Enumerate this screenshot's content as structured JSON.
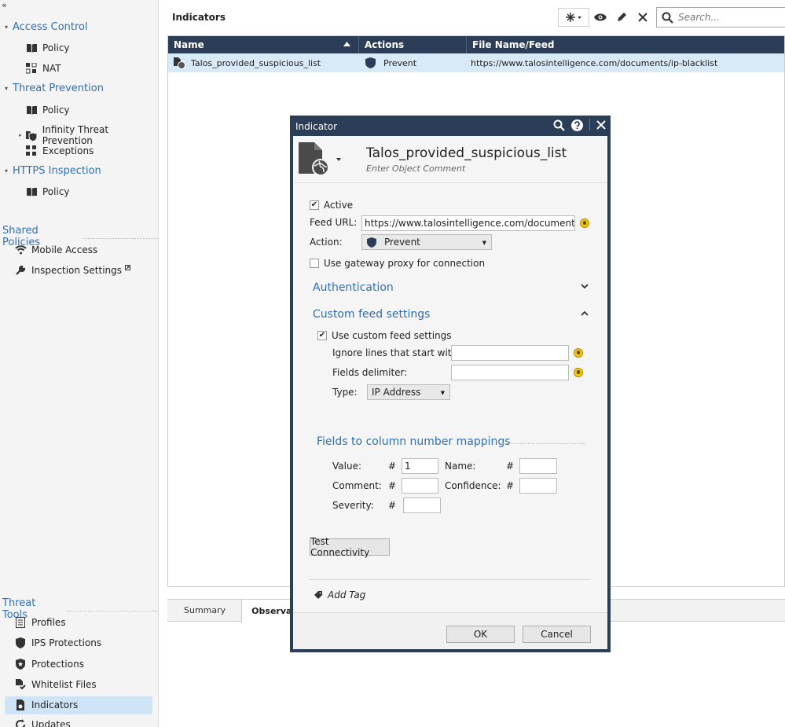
{
  "sidebar": {
    "collapse_glyph": "«",
    "sections": [
      {
        "label": "Access Control",
        "items": [
          {
            "label": "Policy",
            "icon": "book-icon"
          },
          {
            "label": "NAT",
            "icon": "nat-icon"
          }
        ]
      },
      {
        "label": "Threat Prevention",
        "items": [
          {
            "label": "Policy",
            "icon": "book-icon"
          },
          {
            "label": "Infinity Threat Prevention",
            "icon": "shield-book-icon"
          },
          {
            "label": "Exceptions",
            "icon": "exceptions-icon"
          }
        ]
      },
      {
        "label": "HTTPS Inspection",
        "items": [
          {
            "label": "Policy",
            "icon": "book-icon"
          }
        ]
      }
    ],
    "shared_policies": {
      "label": "Shared Policies",
      "items": [
        {
          "label": "Mobile Access",
          "icon": "wifi-icon"
        },
        {
          "label": "Inspection Settings",
          "icon": "wrench-icon"
        }
      ]
    },
    "threat_tools": {
      "label": "Threat Tools",
      "items": [
        {
          "label": "Profiles",
          "icon": "list-icon"
        },
        {
          "label": "IPS Protections",
          "icon": "shield-icon"
        },
        {
          "label": "Protections",
          "icon": "shield-star-icon"
        },
        {
          "label": "Whitelist Files",
          "icon": "file-check-icon"
        },
        {
          "label": "Indicators",
          "icon": "indicator-icon"
        },
        {
          "label": "Updates",
          "icon": "refresh-icon"
        }
      ]
    }
  },
  "main": {
    "title": "Indicators",
    "search_placeholder": "Search...",
    "columns": {
      "name": "Name",
      "actions": "Actions",
      "file": "File Name/Feed"
    },
    "rows": [
      {
        "name": "Talos_provided_suspicious_list",
        "action": "Prevent",
        "feed": "https://www.talosintelligence.com/documents/ip-blacklist"
      }
    ],
    "tabs": {
      "summary": "Summary",
      "observables": "Observables"
    }
  },
  "dialog": {
    "window_title": "Indicator",
    "object_name": "Talos_provided_suspicious_list",
    "comment_placeholder": "Enter Object Comment",
    "active_label": "Active",
    "feed_url_label": "Feed URL:",
    "feed_url_value": "https://www.talosintelligence.com/documents/ip-b",
    "action_label": "Action:",
    "action_value": "Prevent",
    "proxy_label": "Use gateway proxy for connection",
    "authentication_title": "Authentication",
    "custom_feed_title": "Custom feed settings",
    "use_custom_label": "Use custom feed settings",
    "ignore_lines_label": "Ignore lines that start with:",
    "delimiter_label": "Fields delimiter:",
    "type_label": "Type:",
    "type_value": "IP Address",
    "mappings_title": "Fields to column number mappings",
    "value_label": "Value:",
    "value_number": "1",
    "name_label": "Name:",
    "comment_label": "Comment:",
    "confidence_label": "Confidence:",
    "severity_label": "Severity:",
    "hash": "#",
    "test_button": "Test Connectivity",
    "add_tag": "Add Tag",
    "ok": "OK",
    "cancel": "Cancel"
  },
  "colors": {
    "accent": "#2f6fb4",
    "header_dark": "#2c3e57",
    "selection": "#d8e9f7"
  }
}
